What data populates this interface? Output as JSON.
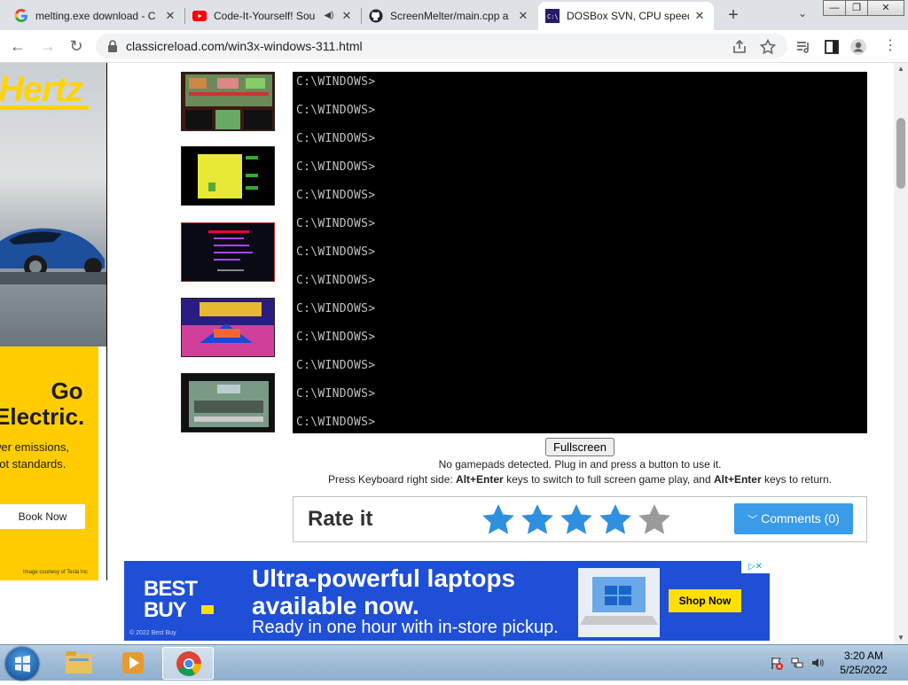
{
  "browser": {
    "tabs": [
      {
        "title": "melting.exe download - C",
        "favicon": "google-g-icon"
      },
      {
        "title": "Code-It-Yourself! Sou",
        "favicon": "youtube-icon",
        "audio": true
      },
      {
        "title": "ScreenMelter/main.cpp a",
        "favicon": "github-icon"
      },
      {
        "title": "DOSBox SVN, CPU speed",
        "favicon": "dosbox-icon",
        "active": true
      }
    ],
    "url": "classicreload.com/win3x-windows-311.html"
  },
  "left_ad": {
    "brand": "Hertz",
    "headline_1": "Go",
    "headline_2": "Electric.",
    "body_1": "wer emissions,",
    "body_2": "not standards.",
    "button": "Book Now",
    "courtesy": "Image courtesy of Tesla Inc"
  },
  "game": {
    "prompt_lines": [
      "C:\\WINDOWS>",
      "C:\\WINDOWS>",
      "C:\\WINDOWS>",
      "C:\\WINDOWS>",
      "C:\\WINDOWS>",
      "C:\\WINDOWS>",
      "C:\\WINDOWS>",
      "C:\\WINDOWS>",
      "C:\\WINDOWS>",
      "C:\\WINDOWS>",
      "C:\\WINDOWS>",
      "C:\\WINDOWS>",
      "C:\\WINDOWS>"
    ],
    "fullscreen_label": "Fullscreen",
    "gamepad_msg": "No gamepads detected. Plug in and press a button to use it.",
    "kb_msg_1": "Press Keyboard right side: ",
    "kb_key_1": "Alt+Enter",
    "kb_msg_2": " keys to switch to full screen game play, and ",
    "kb_key_2": "Alt+Enter",
    "kb_msg_3": " keys to return."
  },
  "rating": {
    "label": "Rate it",
    "stars_filled": 4,
    "stars_total": 5,
    "comments_label": "Comments (0)"
  },
  "bottom_ad": {
    "brand_1": "BEST",
    "brand_2": "BUY",
    "headline_1": "Ultra-powerful laptops",
    "headline_2": "available now.",
    "sub": "Ready in one hour with in-store pickup.",
    "button": "Shop Now",
    "copyright": "© 2022 Best Buy"
  },
  "taskbar": {
    "time": "3:20 AM",
    "date": "5/25/2022"
  },
  "colors": {
    "accent": "#3a9be8",
    "star_filled": "#2f8fe0",
    "star_empty": "#9a9a9a",
    "ad_blue": "#1f4fd6",
    "hertz_yellow": "#ffcc00"
  }
}
